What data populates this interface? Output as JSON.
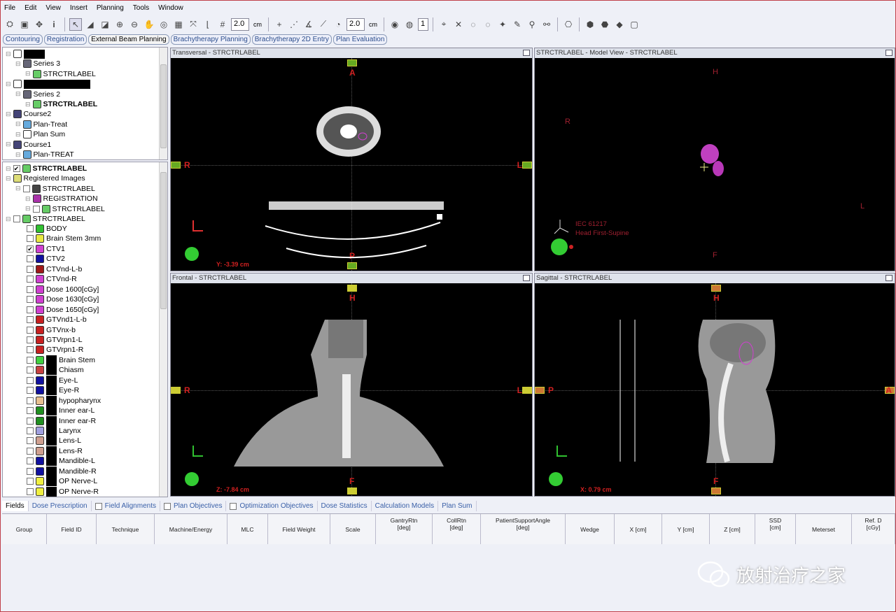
{
  "menu": [
    "File",
    "Edit",
    "View",
    "Insert",
    "Planning",
    "Tools",
    "Window"
  ],
  "toolbar": {
    "grid_value": "2.0",
    "grid_unit": "cm",
    "measure_value": "2.0",
    "measure_unit": "cm",
    "slice_value": "1"
  },
  "module_tabs": [
    {
      "label": "Contouring",
      "active": false
    },
    {
      "label": "Registration",
      "active": false
    },
    {
      "label": "External Beam Planning",
      "active": true
    },
    {
      "label": "Brachytherapy Planning",
      "active": false
    },
    {
      "label": "Brachytherapy 2D Entry",
      "active": false
    },
    {
      "label": "Plan Evaluation",
      "active": false
    }
  ],
  "patient_tree": [
    {
      "label": "",
      "level": 0,
      "icon": "patient-icon",
      "redact": 30
    },
    {
      "label": "Series 3",
      "level": 1,
      "icon": "series-icon"
    },
    {
      "label": "STRCTRLABEL",
      "level": 2,
      "icon": "structure-set-icon"
    },
    {
      "label": "",
      "level": 0,
      "icon": "patient-icon",
      "redact": 95
    },
    {
      "label": "Series 2",
      "level": 1,
      "icon": "series-icon"
    },
    {
      "label": "STRCTRLABEL",
      "level": 2,
      "icon": "structure-set-icon",
      "bold": true
    },
    {
      "label": "Course2",
      "level": 0,
      "icon": "course-icon"
    },
    {
      "label": "Plan-Treat",
      "level": 1,
      "icon": "plan-icon"
    },
    {
      "label": "Plan Sum",
      "level": 1,
      "icon": "plan-sum-icon"
    },
    {
      "label": "Course1",
      "level": 0,
      "icon": "course-icon"
    },
    {
      "label": "Plan-TREAT",
      "level": 1,
      "icon": "plan-icon"
    }
  ],
  "structure_tree_header": [
    {
      "label": "STRCTRLABEL",
      "level": 0,
      "bold": true,
      "checked": true,
      "icon": "structure-set-icon"
    },
    {
      "label": "Registered Images",
      "level": 0,
      "icon": "folder-icon"
    },
    {
      "label": "STRCTRLABEL",
      "level": 1,
      "icon": "image-icon",
      "checkbox": true
    },
    {
      "label": "REGISTRATION",
      "level": 2,
      "icon": "registration-icon"
    },
    {
      "label": "STRCTRLABEL",
      "level": 2,
      "icon": "structure-set-icon",
      "checkbox": true
    },
    {
      "label": "STRCTRLABEL",
      "level": 0,
      "icon": "structure-set-icon",
      "checkbox": true
    }
  ],
  "structures": [
    {
      "name": "BODY",
      "color": "#30c030"
    },
    {
      "name": "Brain Stem 3mm",
      "color": "#e8e840"
    },
    {
      "name": "CTV1",
      "color": "#d040d0",
      "checked": true
    },
    {
      "name": "CTV2",
      "color": "#1010a0"
    },
    {
      "name": "CTVnd-L-b",
      "color": "#a01818"
    },
    {
      "name": "CTVnd-R",
      "color": "#d040d0"
    },
    {
      "name": "Dose 1600[cGy]",
      "color": "#d040d0"
    },
    {
      "name": "Dose 1630[cGy]",
      "color": "#d040d0"
    },
    {
      "name": "Dose 1650[cGy]",
      "color": "#d040d0"
    },
    {
      "name": "GTVnd1-L-b",
      "color": "#c82020"
    },
    {
      "name": "GTVnx-b",
      "color": "#c82020"
    },
    {
      "name": "GTVrpn1-L",
      "color": "#c82020"
    },
    {
      "name": "GTVrpn1-R",
      "color": "#c82020"
    },
    {
      "name": "Brain Stem",
      "color": "#40d040",
      "redact": true
    },
    {
      "name": "Chiasm",
      "color": "#c84040",
      "redact": true
    },
    {
      "name": "Eye-L",
      "color": "#1010a0",
      "redact": true
    },
    {
      "name": "Eye-R",
      "color": "#1010a0",
      "redact": true
    },
    {
      "name": "hypopharynx",
      "color": "#e8c090",
      "redact": true
    },
    {
      "name": "Inner ear-L",
      "color": "#209020",
      "redact": true
    },
    {
      "name": "Inner ear-R",
      "color": "#209020",
      "redact": true
    },
    {
      "name": "Larynx",
      "color": "#a0a0e0",
      "redact": true
    },
    {
      "name": "Lens-L",
      "color": "#d0a090",
      "redact": true
    },
    {
      "name": "Lens-R",
      "color": "#d0a090",
      "redact": true
    },
    {
      "name": "Mandible-L",
      "color": "#1010a0",
      "redact": true
    },
    {
      "name": "Mandible-R",
      "color": "#1010a0",
      "redact": true
    },
    {
      "name": "OP Nerve-L",
      "color": "#f0f040",
      "redact": true
    },
    {
      "name": "OP Nerve-R",
      "color": "#f0f040",
      "redact": true
    }
  ],
  "viewers": {
    "transversal": {
      "title": "Transversal - STRCTRLABEL",
      "top": "A",
      "bottom": "P",
      "left": "R",
      "right": "L",
      "coord": "Y: -3.39 cm"
    },
    "model": {
      "title": "STRCTRLABEL  -  Model View - STRCTRLABEL",
      "top": "H",
      "bottom": "F",
      "left": "R",
      "right": "L",
      "standard": "IEC 61217",
      "orientation": "Head First-Supine"
    },
    "frontal": {
      "title": "Frontal - STRCTRLABEL",
      "top": "H",
      "bottom": "F",
      "left": "R",
      "right": "L",
      "coord": "Z: -7.84 cm"
    },
    "sagittal": {
      "title": "Sagittal - STRCTRLABEL",
      "top": "H",
      "bottom": "F",
      "left": "P",
      "right": "A",
      "coord": "X: 0.79 cm"
    }
  },
  "bottom_tabs": [
    {
      "label": "Fields",
      "active": true
    },
    {
      "label": "Dose Prescription"
    },
    {
      "label": "Field Alignments",
      "checkbox": true
    },
    {
      "label": "Plan Objectives",
      "checkbox": true
    },
    {
      "label": "Optimization Objectives",
      "checkbox": true
    },
    {
      "label": "Dose Statistics"
    },
    {
      "label": "Calculation Models"
    },
    {
      "label": "Plan Sum"
    }
  ],
  "field_columns": [
    "Group",
    "Field ID",
    "Technique",
    "Machine/Energy",
    "MLC",
    "Field Weight",
    "Scale",
    "GantryRtn\n[deg]",
    "CollRtn\n[deg]",
    "PatientSupportAngle\n[deg]",
    "Wedge",
    "X [cm]",
    "Y [cm]",
    "Z [cm]",
    "SSD\n[cm]",
    "Meterset",
    "Ref. D\n[cGy]"
  ],
  "watermark": "放射治疗之家"
}
